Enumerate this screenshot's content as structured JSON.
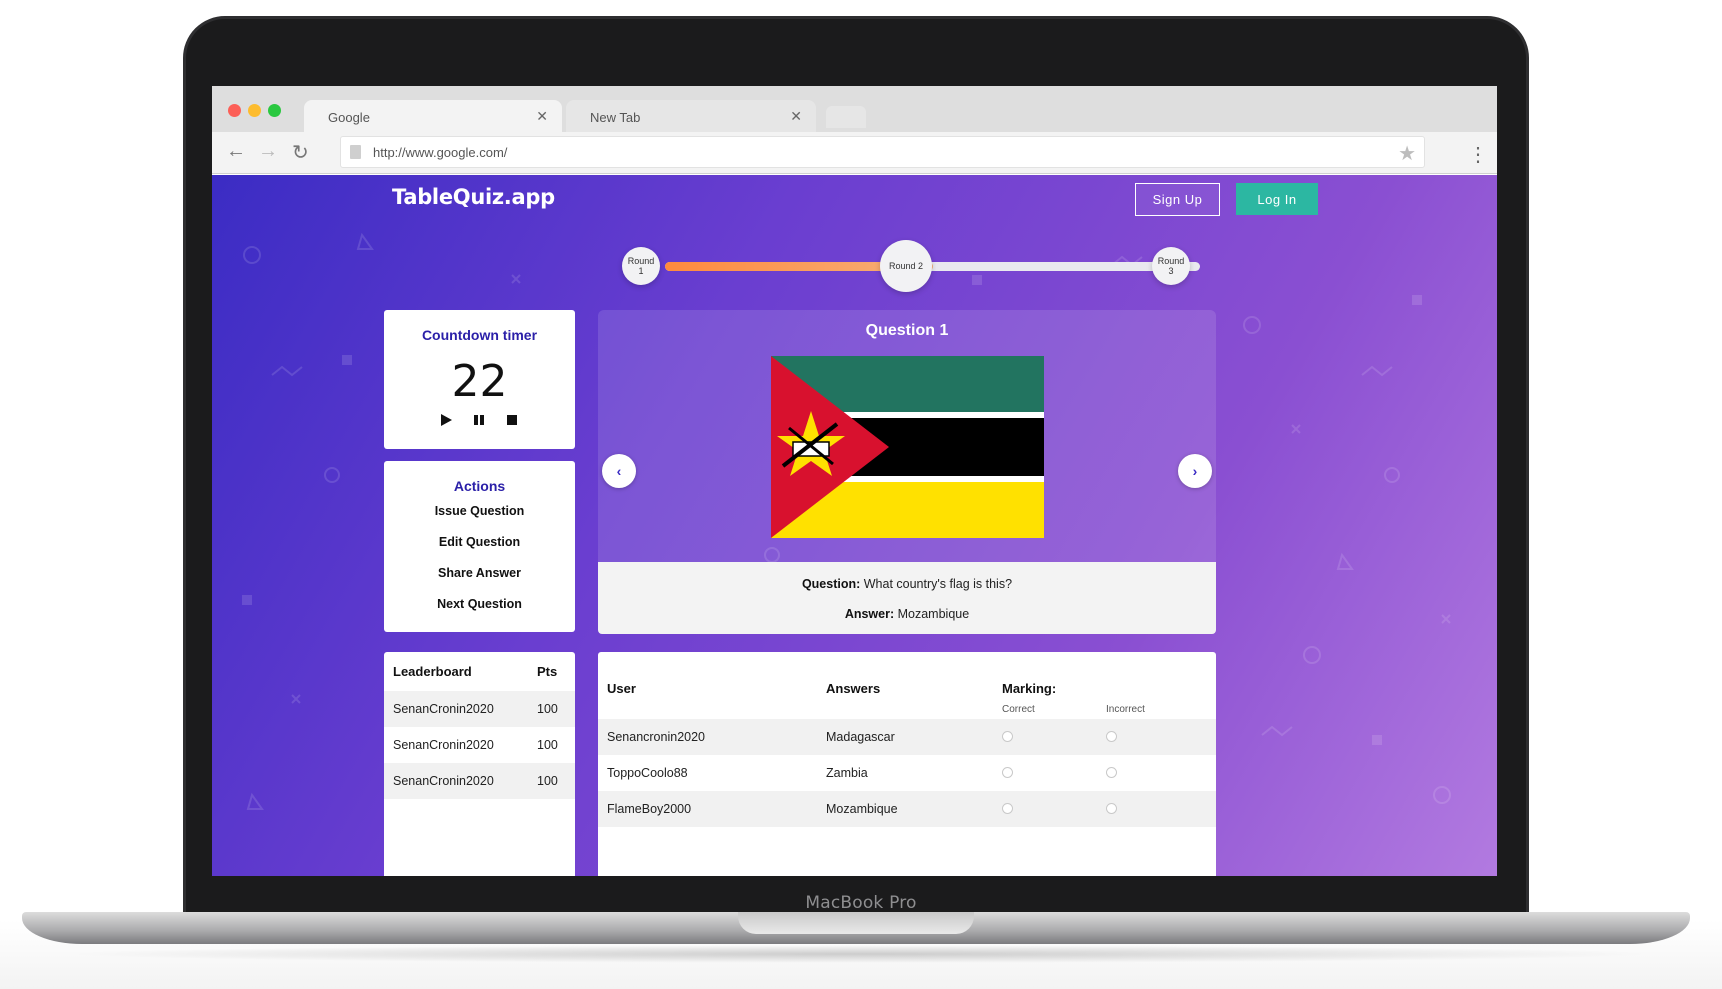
{
  "device": {
    "label": "MacBook Pro"
  },
  "browser": {
    "tabs": [
      {
        "label": "Google",
        "close": "✕"
      },
      {
        "label": "New Tab",
        "close": "✕"
      }
    ],
    "url": "http://www.google.com/",
    "traffic_lights": {
      "close": "#fc5f57",
      "minimize": "#fdbc2e",
      "zoom": "#2ac840"
    },
    "icons": [
      "back-arrow-icon",
      "forward-arrow-icon",
      "reload-icon",
      "page-icon",
      "star-icon",
      "kebab-menu-icon"
    ]
  },
  "app": {
    "logo": "TableQuiz.app",
    "sign_up": "Sign Up",
    "log_in": "Log In",
    "colors": {
      "accent": "#2a1fa8",
      "login_button": "#2cb7a2",
      "progress": "#ff8a3d"
    },
    "rounds": {
      "items": [
        {
          "line1": "Round",
          "line2": "1"
        },
        {
          "line1": "Round 2",
          "line2": ""
        },
        {
          "line1": "Round",
          "line2": "3"
        }
      ],
      "current": 2,
      "progress_fraction": 0.5
    },
    "timer": {
      "title": "Countdown timer",
      "value": "22",
      "controls": [
        "play-icon",
        "pause-icon",
        "stop-icon"
      ]
    },
    "actions": {
      "title": "Actions",
      "items": [
        "Issue Question",
        "Edit Question",
        "Share Answer",
        "Next Question"
      ]
    },
    "leaderboard": {
      "headers": {
        "user": "Leaderboard",
        "pts": "Pts"
      },
      "rows": [
        {
          "user": "SenanCronin2020",
          "pts": "100"
        },
        {
          "user": "SenanCronin2020",
          "pts": "100"
        },
        {
          "user": "SenanCronin2020",
          "pts": "100"
        }
      ]
    },
    "question": {
      "title": "Question 1",
      "image": "flag of Mozambique",
      "question_label": "Question:",
      "question_text": " What country's flag is this?",
      "answer_label": "Answer:",
      "answer_text": " Mozambique",
      "prev": "‹",
      "next": "›"
    },
    "answers": {
      "headers": {
        "user": "User",
        "answers": "Answers",
        "marking": "Marking:",
        "correct": "Correct",
        "incorrect": "Incorrect"
      },
      "rows": [
        {
          "user": "Senancronin2020",
          "answer": "Madagascar"
        },
        {
          "user": "ToppoCoolo88",
          "answer": "Zambia"
        },
        {
          "user": "FlameBoy2000",
          "answer": "Mozambique"
        }
      ]
    }
  }
}
